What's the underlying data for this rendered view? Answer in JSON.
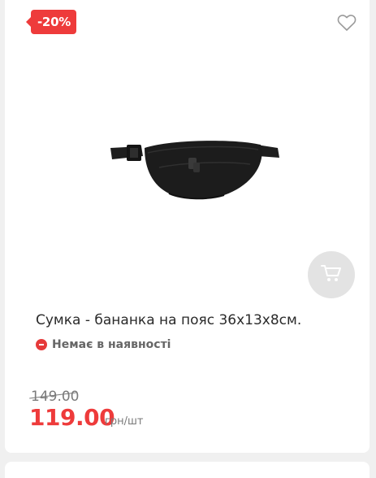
{
  "badge": {
    "discount": "-20%"
  },
  "product": {
    "title": "Сумка - бананка на пояс 36x13x8см.",
    "stock_status": "Немає в наявності"
  },
  "price": {
    "old": "149.00",
    "current": "119.00",
    "unit": "грн/шт"
  },
  "icons": {
    "favorite": "heart-outline-icon",
    "cart": "cart-icon",
    "stock": "minus-circle-icon"
  },
  "colors": {
    "accent": "#ee3b3b",
    "cart_button_bg": "#e3e3e3",
    "text": "#2a2a2a",
    "muted": "#7a7a7a"
  }
}
